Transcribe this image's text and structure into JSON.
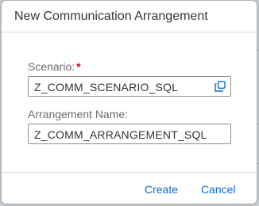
{
  "dialog": {
    "title": "New Communication Arrangement"
  },
  "form": {
    "scenario": {
      "label": "Scenario:",
      "required_marker": "*",
      "value": "Z_COMM_SCENARIO_SQL",
      "value_help_icon": "value-help-icon"
    },
    "arrangement_name": {
      "label": "Arrangement Name:",
      "value": "Z_COMM_ARRANGEMENT_SQL"
    }
  },
  "footer": {
    "create_label": "Create",
    "cancel_label": "Cancel"
  },
  "colors": {
    "accent": "#0a6ed1",
    "required": "#d0021b",
    "title_text": "#32363a",
    "label_text": "#6a6d70"
  }
}
